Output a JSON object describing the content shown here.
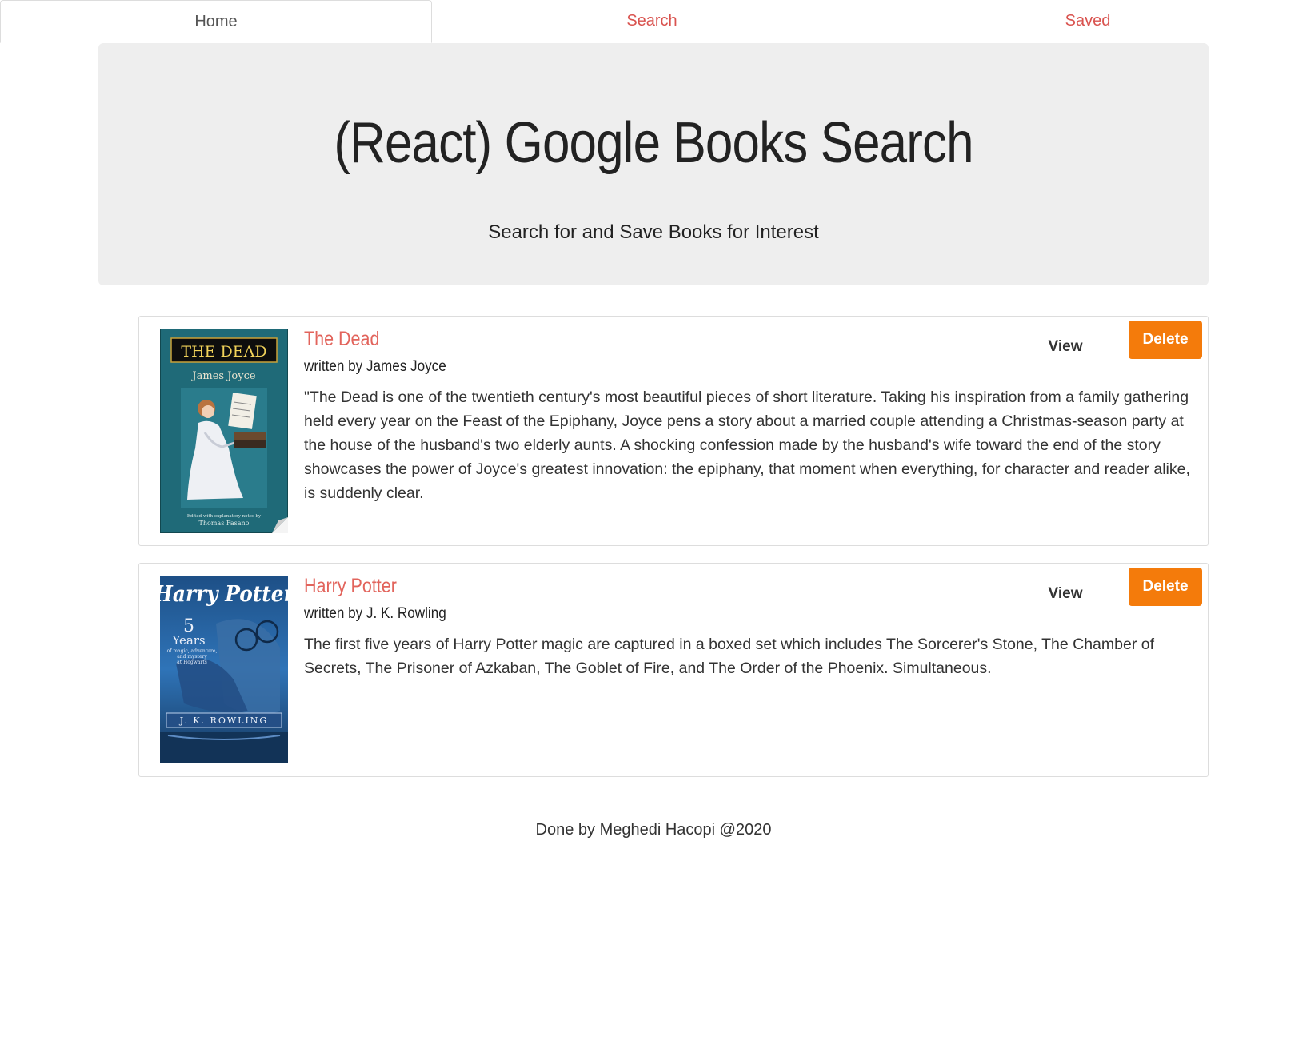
{
  "nav": {
    "tabs": [
      {
        "label": "Home",
        "active": true
      },
      {
        "label": "Search",
        "active": false
      },
      {
        "label": "Saved",
        "active": false
      }
    ]
  },
  "hero": {
    "title": "(React) Google Books Search",
    "subtitle": "Search for and Save Books for Interest"
  },
  "books": [
    {
      "title": "The Dead",
      "author": "written by James Joyce",
      "description": "\"The Dead is one of the twentieth century's most beautiful pieces of short literature. Taking his inspiration from a family gathering held every year on the Feast of the Epiphany, Joyce pens a story about a married couple attending a Christmas-season party at the house of the husband's two elderly aunts. A shocking confession made by the husband's wife toward the end of the story showcases the power of Joyce's greatest innovation: the epiphany, that moment when everything, for character and reader alike, is suddenly clear.",
      "view_label": "View",
      "delete_label": "Delete",
      "cover": {
        "title": "THE DEAD",
        "author": "James Joyce",
        "footer_line1": "Edited with explanatory notes by",
        "footer_line2": "Thomas Fasano"
      }
    },
    {
      "title": "Harry Potter",
      "author": "written by J. K. Rowling",
      "description": "The first five years of Harry Potter magic are captured in a boxed set which includes The Sorcerer's Stone, The Chamber of Secrets, The Prisoner of Azkaban, The Goblet of Fire, and The Order of the Phoenix. Simultaneous.",
      "view_label": "View",
      "delete_label": "Delete",
      "cover": {
        "title": "Harry Potter",
        "number": "5",
        "years": "Years",
        "tagline1": "of magic, adventure,",
        "tagline2": "and mystery",
        "tagline3": "at Hogwarts",
        "author": "J. K. ROWLING"
      }
    }
  ],
  "footer": {
    "text": "Done by Meghedi Hacopi @2020"
  },
  "colors": {
    "link": "#d9534f",
    "book_title": "#e2645c",
    "delete_button": "#f47b0b",
    "jumbotron_bg": "#eeeeee"
  }
}
